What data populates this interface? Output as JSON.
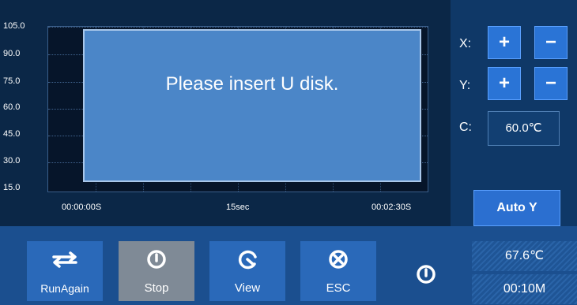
{
  "chart_data": {
    "type": "line",
    "y_ticks": [
      "105.0",
      "90.0",
      "75.0",
      "60.0",
      "45.0",
      "30.0",
      "15.0"
    ],
    "x_ticks": [
      "00:00:00S",
      "15sec",
      "00:02:30S"
    ],
    "ylim": [
      15,
      105
    ],
    "grid": true,
    "series": []
  },
  "dialog": {
    "message": "Please insert U disk."
  },
  "controls": {
    "x_label": "X:",
    "y_label": "Y:",
    "c_label": "C:",
    "plus": "+",
    "minus": "−",
    "c_value": "60.0℃",
    "auto_y": "Auto Y"
  },
  "actions": {
    "run_again": "RunAgain",
    "stop": "Stop",
    "view": "View",
    "esc": "ESC"
  },
  "status": {
    "temperature": "67.6℃",
    "time": "00:10M"
  },
  "colors": {
    "accent": "#2a74d6",
    "dialog": "#4b86c8",
    "stop_button": "#7f8a96"
  }
}
